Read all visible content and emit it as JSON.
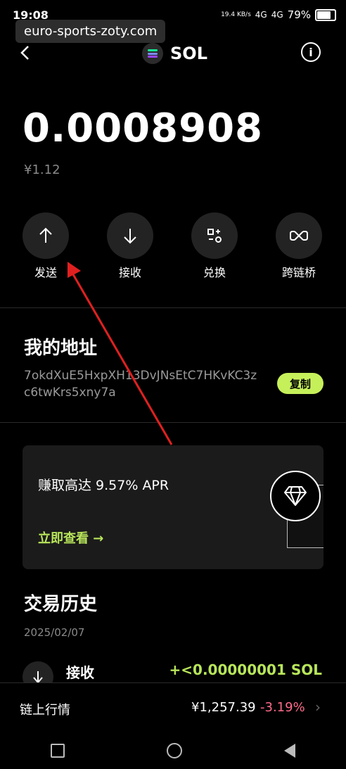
{
  "status_bar": {
    "time": "19:08",
    "speed": "19.4 KB/s",
    "network1": "4G",
    "network2": "4G",
    "battery": "79%"
  },
  "watermark": "euro-sports-zoty.com",
  "header": {
    "back_icon": "chevron-left-icon",
    "token": "SOL",
    "info_icon": "info-icon"
  },
  "balance": {
    "amount": "0.0008908",
    "fiat": "¥1.12"
  },
  "actions": [
    {
      "label": "发送",
      "icon": "arrow-up-icon"
    },
    {
      "label": "接收",
      "icon": "arrow-down-icon"
    },
    {
      "label": "兑换",
      "icon": "swap-icon"
    },
    {
      "label": "跨链桥",
      "icon": "bridge-icon"
    }
  ],
  "address": {
    "title": "我的地址",
    "value": "7okdXuE5HxpXH13DvJNsEtC7HKvKC3zc6twKrs5xny7a",
    "copy_label": "复制"
  },
  "earn": {
    "headline": "赚取高达 9.57% APR",
    "cta": "立即查看 →"
  },
  "history": {
    "title": "交易历史",
    "date": "2025/02/07",
    "items": [
      {
        "type": "接收",
        "amount": "+<0.00000001 SOL"
      }
    ]
  },
  "market": {
    "label": "链上行情",
    "price": "¥1,257.39",
    "change": "-3.19%"
  },
  "colors": {
    "accent": "#c6f05a",
    "negative": "#ff6b8a",
    "annotation_arrow": "#e02020"
  }
}
